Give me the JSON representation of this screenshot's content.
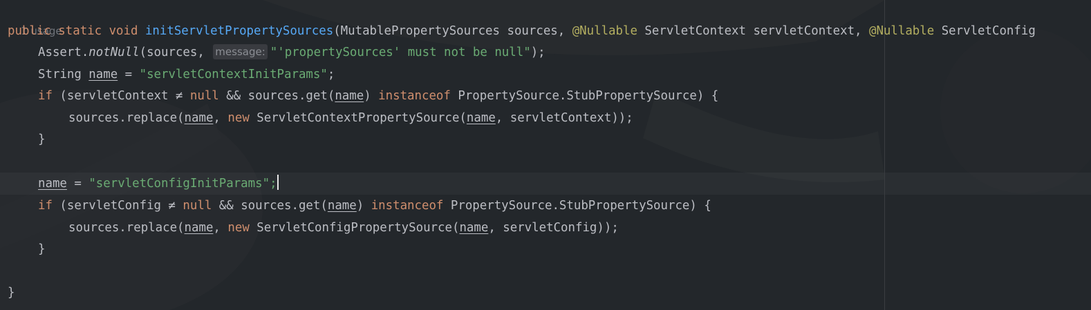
{
  "editor": {
    "usage_hint": "1 usage",
    "code": {
      "sig_kw": "public static void",
      "sig_method": "initServletPropertySources",
      "sig_open": "(MutablePropertySources sources, ",
      "sig_ann1": "@Nullable",
      "sig_mid": " ServletContext servletContext, ",
      "sig_ann2": "@Nullable",
      "sig_end": " ServletConfig",
      "assert_class": "Assert.",
      "assert_method": "notNull",
      "assert_open": "(sources, ",
      "param_hint": "message:",
      "assert_msg": "\"'propertySources' must not be null\"",
      "assert_end": ");",
      "decl_type": "String ",
      "var_name": "name",
      "assign": " = ",
      "decl_value": "\"servletContextInitParams\"",
      "semicolon": ";",
      "if1_open": "if",
      "if1_cond_a": " (servletContext ≠ ",
      "null_kw": "null",
      "if1_cond_b": " && sources.get(",
      "close_paren": ")",
      "instanceof_kw": "instanceof",
      "if_tail": " PropertySource.StubPropertySource) {",
      "replace_open": "sources.replace(",
      "comma_space": ", ",
      "new_kw": "new",
      "replace1_class": " ServletContextPropertySource(",
      "replace1_end": ", servletContext));",
      "close_brace": "}",
      "assign2_value": "\"servletConfigInitParams\"",
      "if2_cond_a": " (servletConfig ≠ ",
      "replace2_class": " ServletConfigPropertySource(",
      "replace2_end": ", servletConfig));"
    }
  },
  "colors": {
    "background": "#23272b",
    "keyword": "#cf8e6d",
    "method": "#56a8f5",
    "annotation": "#b3ae60",
    "string": "#6aab73"
  }
}
